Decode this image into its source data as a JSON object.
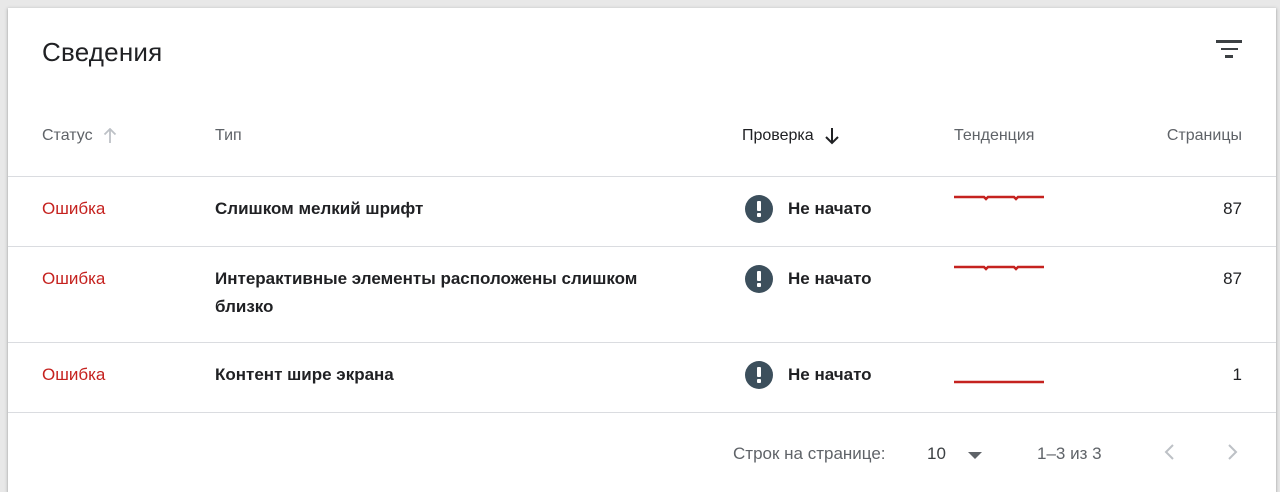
{
  "card": {
    "title": "Сведения",
    "filter_icon": "filter-list-icon"
  },
  "columns": {
    "status": "Статус",
    "type": "Тип",
    "check": "Проверка",
    "trend": "Тенденция",
    "pages": "Страницы"
  },
  "rows": [
    {
      "status": "Ошибка",
      "type": "Слишком мелкий шрифт",
      "check": "Не начато",
      "pages": "87"
    },
    {
      "status": "Ошибка",
      "type": "Интерактивные элементы расположены слишком близко",
      "check": "Не начато",
      "pages": "87"
    },
    {
      "status": "Ошибка",
      "type": "Контент шире экрана",
      "check": "Не начато",
      "pages": "1"
    }
  ],
  "footer": {
    "rows_per_page_label": "Строк на странице:",
    "rows_per_page_value": "10",
    "range": "1–3 из 3"
  },
  "colors": {
    "error": "#c5221f",
    "badge": "#3c4f5c",
    "trend_line": "#c5221f"
  }
}
